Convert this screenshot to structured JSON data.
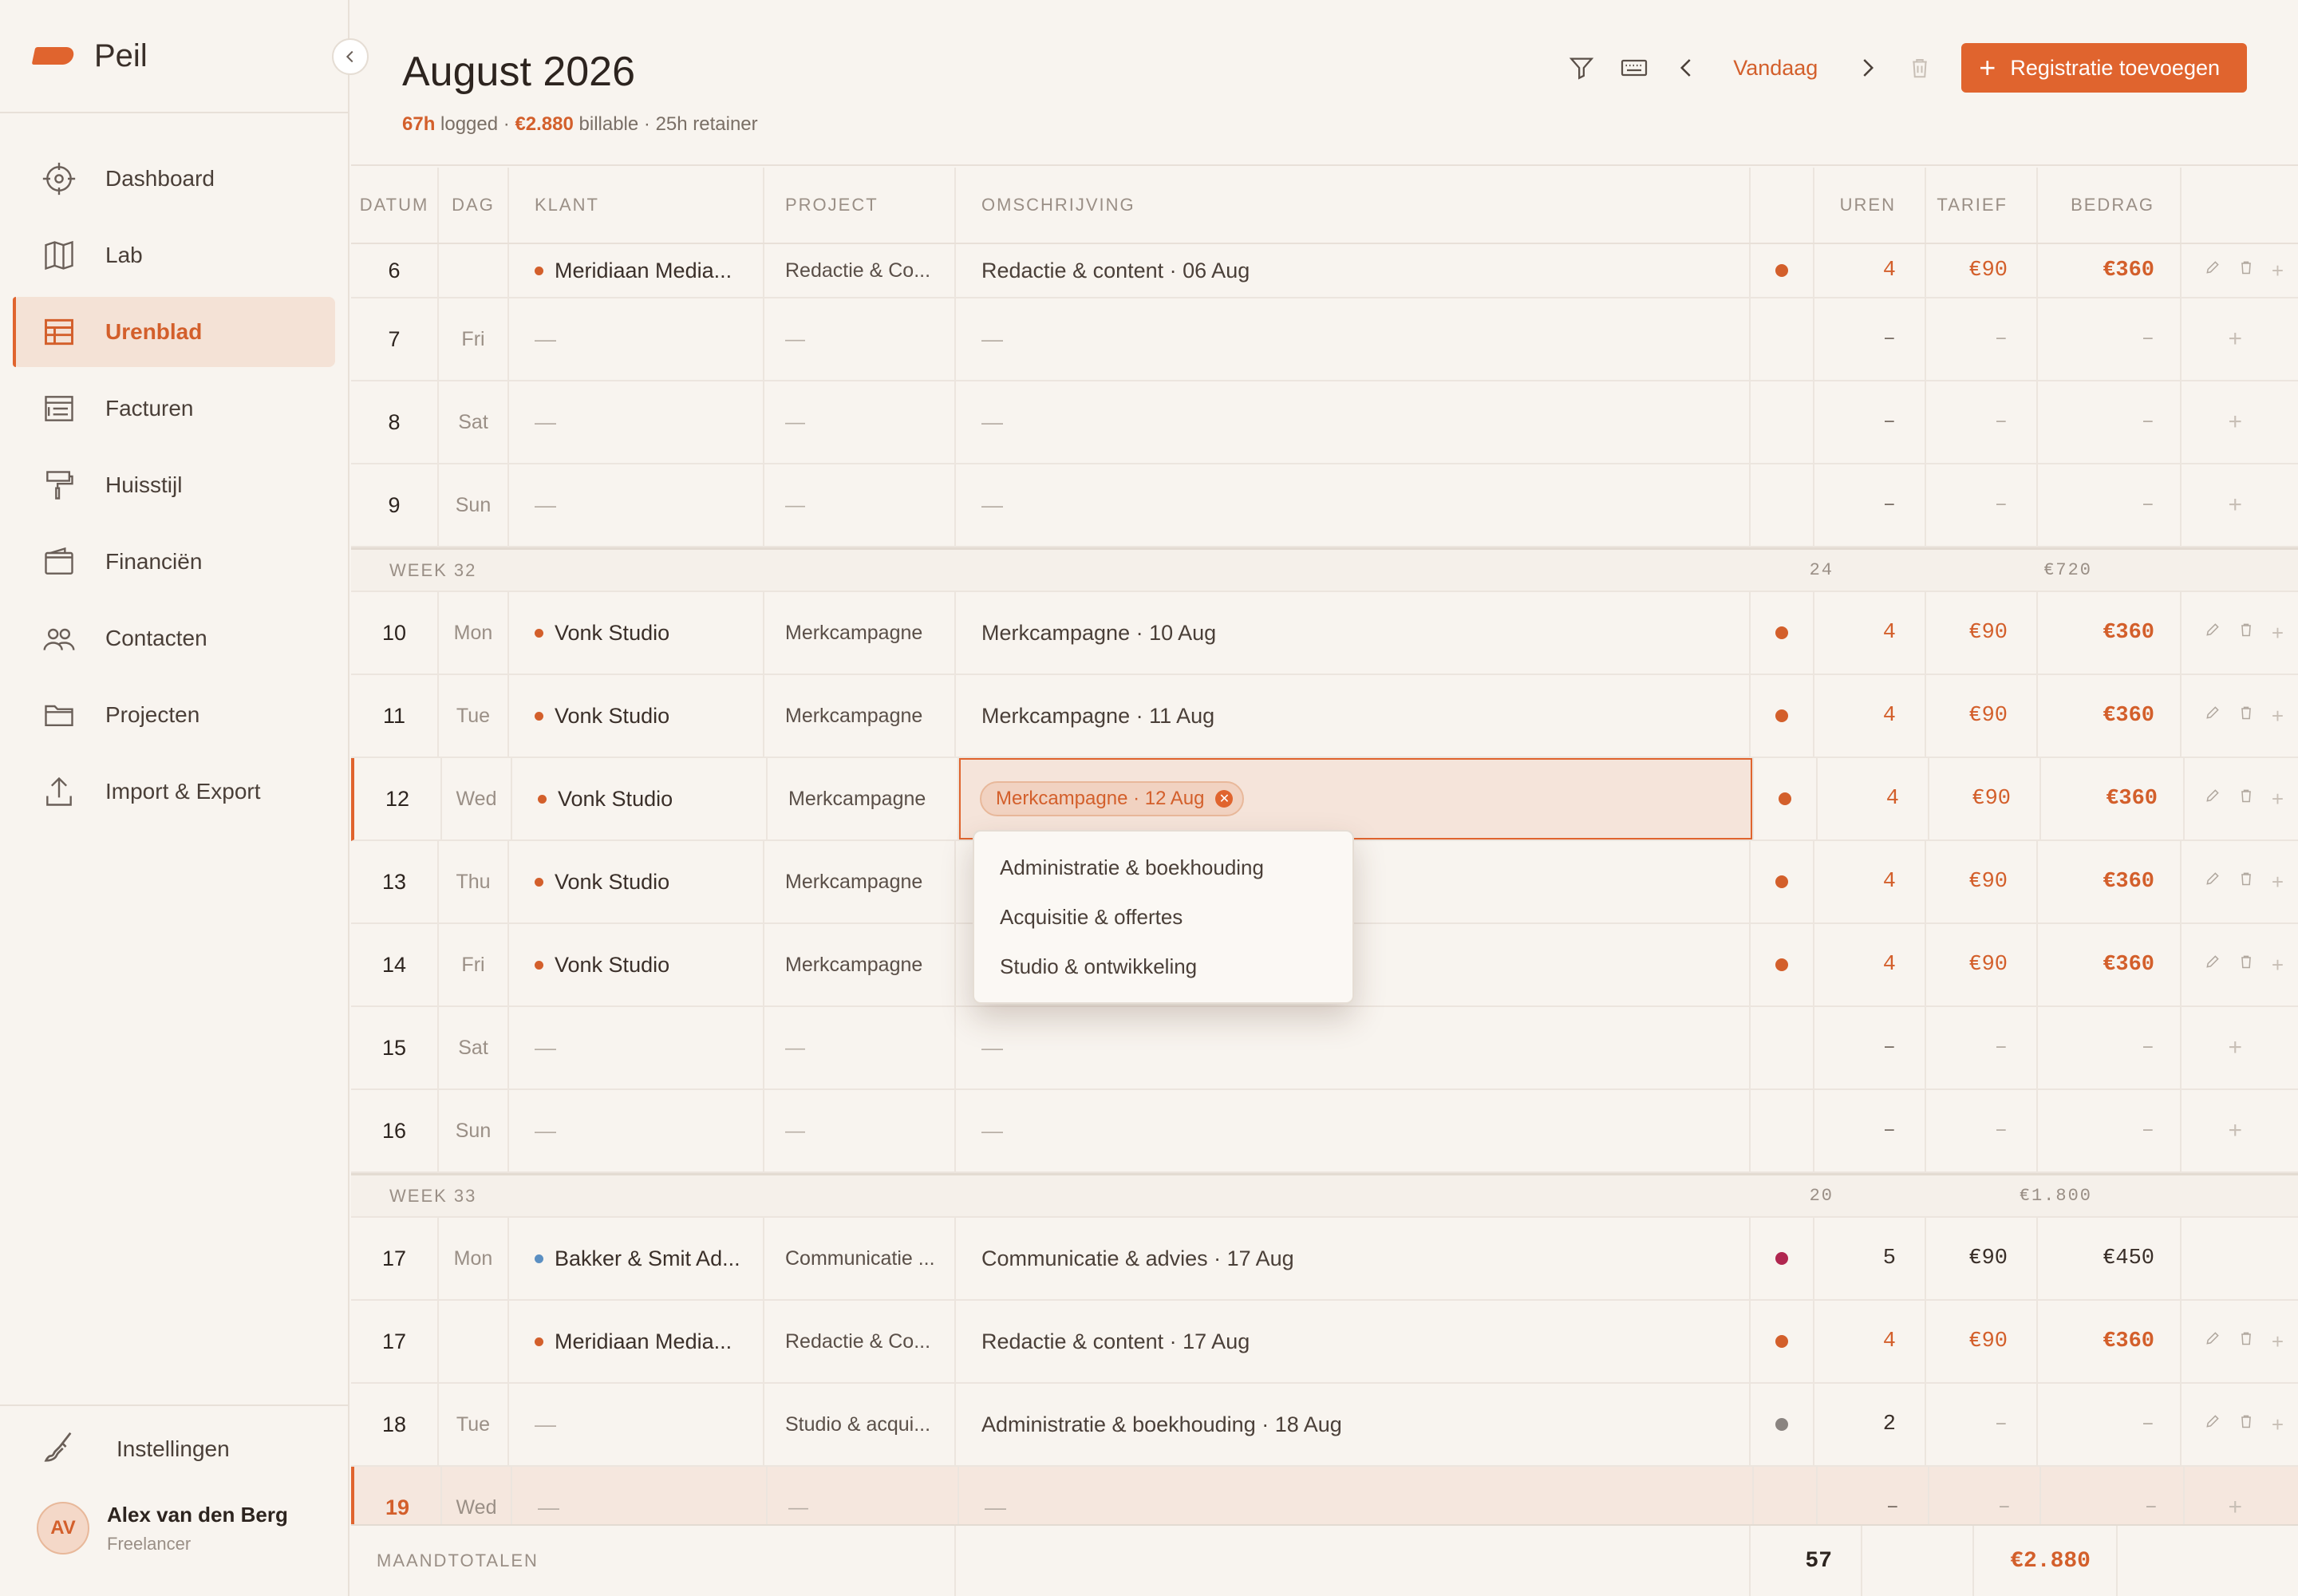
{
  "app": {
    "name": "Peil"
  },
  "nav": [
    {
      "label": "Dashboard",
      "icon": "compass-icon",
      "active": false
    },
    {
      "label": "Lab",
      "icon": "map-icon",
      "active": false
    },
    {
      "label": "Urenblad",
      "icon": "table-icon",
      "active": true
    },
    {
      "label": "Facturen",
      "icon": "invoice-icon",
      "active": false
    },
    {
      "label": "Huisstijl",
      "icon": "paint-roller-icon",
      "active": false
    },
    {
      "label": "Financiën",
      "icon": "wallet-icon",
      "active": false
    },
    {
      "label": "Contacten",
      "icon": "users-icon",
      "active": false
    },
    {
      "label": "Projecten",
      "icon": "folder-icon",
      "active": false
    },
    {
      "label": "Import & Export",
      "icon": "upload-icon",
      "active": false
    }
  ],
  "settings": {
    "label": "Instellingen"
  },
  "user": {
    "initials": "AV",
    "name": "Alex van den Berg",
    "role": "Freelancer"
  },
  "header": {
    "title": "August 2026",
    "hours": "67h",
    "hours_suffix": "logged ·",
    "billable": "€2.880",
    "billable_suffix": "billable · 25h retainer",
    "today_label": "Vandaag",
    "add_label": "Registratie toevoegen"
  },
  "columns": {
    "datum": "DATUM",
    "dag": "DAG",
    "klant": "KLANT",
    "project": "PROJECT",
    "omschrijving": "OMSCHRIJVING",
    "uren": "UREN",
    "tarief": "TARIEF",
    "bedrag": "BEDRAG"
  },
  "rows_a": [
    {
      "datum": "6",
      "dag": "",
      "klant": "Meridiaan Media...",
      "project": "Redactie & Co...",
      "oms": "Redactie & content · 06 Aug",
      "uren": "4",
      "tarief": "€90",
      "bedrag": "€360",
      "color": "#d35f2b",
      "billable": true,
      "short": true
    },
    {
      "datum": "7",
      "dag": "Fri",
      "klant": "",
      "project": "",
      "oms": "",
      "uren": "–",
      "tarief": "–",
      "bedrag": "–"
    },
    {
      "datum": "8",
      "dag": "Sat",
      "klant": "",
      "project": "",
      "oms": "",
      "uren": "–",
      "tarief": "–",
      "bedrag": "–"
    },
    {
      "datum": "9",
      "dag": "Sun",
      "klant": "",
      "project": "",
      "oms": "",
      "uren": "–",
      "tarief": "–",
      "bedrag": "–"
    }
  ],
  "week32": {
    "label": "WEEK 32",
    "uren": "24",
    "bedrag": "€720"
  },
  "rows_b": [
    {
      "datum": "10",
      "dag": "Mon",
      "klant": "Vonk Studio",
      "project": "Merkcampagne",
      "oms": "Merkcampagne · 10 Aug",
      "uren": "4",
      "tarief": "€90",
      "bedrag": "€360",
      "color": "#d35f2b",
      "billable": true
    },
    {
      "datum": "11",
      "dag": "Tue",
      "klant": "Vonk Studio",
      "project": "Merkcampagne",
      "oms": "Merkcampagne · 11 Aug",
      "uren": "4",
      "tarief": "€90",
      "bedrag": "€360",
      "color": "#d35f2b",
      "billable": true
    },
    {
      "datum": "12",
      "dag": "Wed",
      "klant": "Vonk Studio",
      "project": "Merkcampagne",
      "oms": "Merkcampagne · 12 Aug",
      "uren": "4",
      "tarief": "€90",
      "bedrag": "€360",
      "color": "#d35f2b",
      "billable": true,
      "editing": true
    },
    {
      "datum": "13",
      "dag": "Thu",
      "klant": "Vonk Studio",
      "project": "Merkcampagne",
      "oms": "",
      "uren": "4",
      "tarief": "€90",
      "bedrag": "€360",
      "color": "#d35f2b",
      "billable": true
    },
    {
      "datum": "14",
      "dag": "Fri",
      "klant": "Vonk Studio",
      "project": "Merkcampagne",
      "oms": "",
      "uren": "4",
      "tarief": "€90",
      "bedrag": "€360",
      "color": "#d35f2b",
      "billable": true
    },
    {
      "datum": "15",
      "dag": "Sat",
      "klant": "",
      "project": "",
      "oms": "",
      "uren": "–",
      "tarief": "–",
      "bedrag": "–"
    },
    {
      "datum": "16",
      "dag": "Sun",
      "klant": "",
      "project": "",
      "oms": "",
      "uren": "–",
      "tarief": "–",
      "bedrag": "–"
    }
  ],
  "week33": {
    "label": "WEEK 33",
    "uren": "20",
    "bedrag": "€1.800"
  },
  "rows_c": [
    {
      "datum": "17",
      "dag": "Mon",
      "klant": "Bakker & Smit Ad...",
      "project": "Communicatie ...",
      "oms": "Communicatie & advies · 17 Aug",
      "uren": "5",
      "tarief": "€90",
      "bedrag": "€450",
      "color": "#b0264f",
      "klant_dot": "#5b8fc2",
      "billable": false,
      "noactions": true
    },
    {
      "datum": "17",
      "dag": "",
      "klant": "Meridiaan Media...",
      "project": "Redactie & Co...",
      "oms": "Redactie & content · 17 Aug",
      "uren": "4",
      "tarief": "€90",
      "bedrag": "€360",
      "color": "#d35f2b",
      "billable": true
    },
    {
      "datum": "18",
      "dag": "Tue",
      "klant": "",
      "project": "Studio & acqui...",
      "oms": "Administratie & boekhouding · 18 Aug",
      "uren": "2",
      "tarief": "–",
      "bedrag": "–",
      "color": "#8a8480",
      "billable": false
    },
    {
      "datum": "19",
      "dag": "Wed",
      "klant": "",
      "project": "",
      "oms": "",
      "uren": "–",
      "tarief": "–",
      "bedrag": "–",
      "today": true
    }
  ],
  "dropdown": [
    "Administratie & boekhouding",
    "Acquisitie & offertes",
    "Studio & ontwikkeling"
  ],
  "totals": {
    "label": "MAANDTOTALEN",
    "uren": "57",
    "bedrag": "€2.880"
  },
  "colors": {
    "accent": "#e0642e",
    "accent_text": "#d35f2b",
    "background": "#f8f4ef"
  }
}
